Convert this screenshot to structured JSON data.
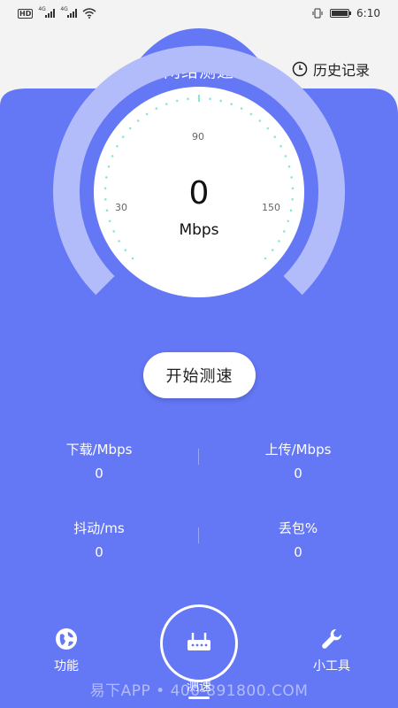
{
  "status_bar": {
    "network_badge": "HD",
    "signal1_label": "4G",
    "signal2_label": "4G",
    "time": "6:10"
  },
  "header": {
    "title": "网络测速",
    "history_label": "历史记录"
  },
  "gauge": {
    "value": "0",
    "unit": "Mbps",
    "tick_labels": [
      "30",
      "90",
      "150"
    ]
  },
  "start_button_label": "开始测速",
  "stats": [
    {
      "label": "下载/Mbps",
      "value": "0"
    },
    {
      "label": "上传/Mbps",
      "value": "0"
    },
    {
      "label": "抖动/ms",
      "value": "0"
    },
    {
      "label": "丢包%",
      "value": "0"
    }
  ],
  "bottom_nav": {
    "left_label": "功能",
    "center_label": "测速",
    "right_label": "小工具"
  },
  "watermark": "易下APP • 400-891800.COM",
  "colors": {
    "primary": "#6477f5",
    "arc_light": "#b3bcfb",
    "dial_dots": "#8fe4d8"
  }
}
